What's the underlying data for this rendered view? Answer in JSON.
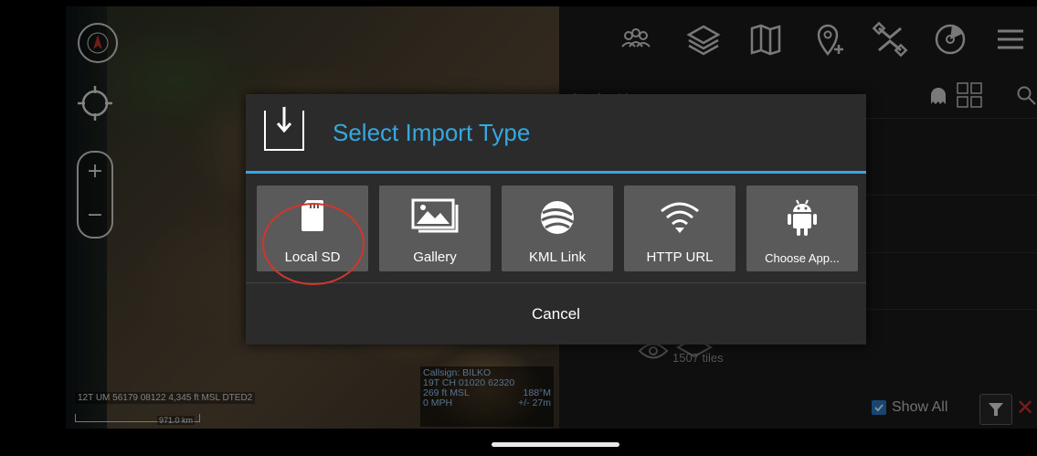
{
  "map": {
    "coordinate_readout": "12T UM 56179 08122 4,345 ft MSL DTED2",
    "scale_label": "971.0 km",
    "callsign": {
      "line1": "Callsign: BILKO",
      "line2_left": "19T  CH  01020  62320",
      "line3_left": "269 ft MSL",
      "line3_right": "188°M",
      "line4_left": "0 MPH",
      "line4_right": "+/- 27m"
    }
  },
  "toolbar": {
    "icons": [
      "contacts-icon",
      "layers-icon",
      "map-icon",
      "add-point-icon",
      "tools-icon",
      "radar-icon",
      "menu-icon"
    ]
  },
  "panel": {
    "title": "Overlay Manager",
    "tiles_label": "1507 tiles",
    "show_all_label": "Show All"
  },
  "dialog": {
    "title": "Select Import Type",
    "options": [
      {
        "label": "Local SD",
        "icon": "sd-card-icon"
      },
      {
        "label": "Gallery",
        "icon": "gallery-icon"
      },
      {
        "label": "KML Link",
        "icon": "globe-icon"
      },
      {
        "label": "HTTP URL",
        "icon": "wifi-icon"
      },
      {
        "label": "Choose App...",
        "icon": "android-icon"
      }
    ],
    "cancel_label": "Cancel"
  },
  "colors": {
    "accent": "#35a8e0",
    "option_bg": "#5a5a5a",
    "highlight": "#d0362c"
  }
}
